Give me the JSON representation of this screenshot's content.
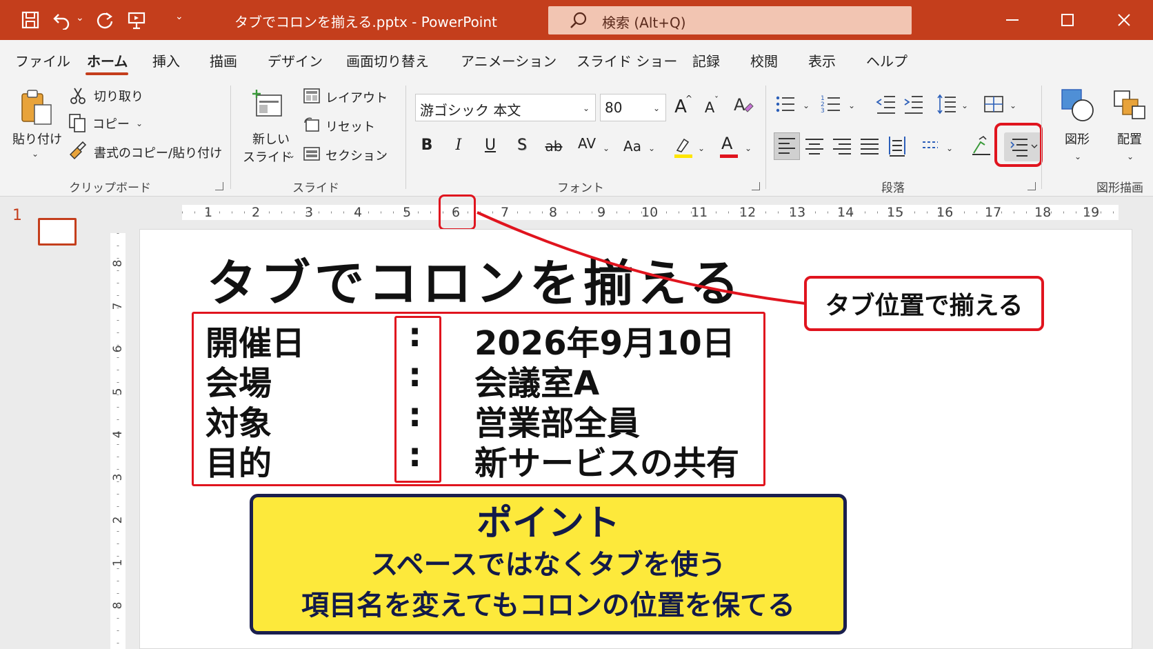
{
  "titlebar": {
    "doc_title": "タブでコロンを揃える.pptx  -  PowerPoint",
    "search_text": "検索 (Alt+Q)"
  },
  "menu": {
    "tabs": [
      "ファイル",
      "ホーム",
      "挿入",
      "描画",
      "デザイン",
      "画面切り替え",
      "アニメーション",
      "スライド ショー",
      "記録",
      "校閲",
      "表示",
      "ヘルプ"
    ],
    "active": "ホーム"
  },
  "ribbon": {
    "clipboard": {
      "paste": "貼り付け",
      "cut": "切り取り",
      "copy": "コピー",
      "format_painter": "書式のコピー/貼り付け",
      "group": "クリップボード"
    },
    "slides": {
      "new_slide_1": "新しい",
      "new_slide_2": "スライド",
      "layout": "レイアウト",
      "reset": "リセット",
      "section": "セクション",
      "group": "スライド"
    },
    "font": {
      "family": "游ゴシック 本文",
      "size": "80",
      "group": "フォント",
      "bold": "B",
      "italic": "I",
      "underline": "U",
      "shadow": "S",
      "strike": "ab",
      "spacing": "AV",
      "case": "Aa",
      "grow": "A",
      "shrink": "A",
      "color_a": "A"
    },
    "paragraph": {
      "group": "段落"
    },
    "drawing": {
      "shapes": "図形",
      "arrange": "配置",
      "group": "図形描画"
    }
  },
  "thumbnail": {
    "number": "1"
  },
  "ruler": {
    "h_numbers": [
      "1",
      "2",
      "3",
      "4",
      "5",
      "6",
      "7",
      "8",
      "9",
      "10",
      "11",
      "12",
      "13",
      "14",
      "15",
      "16",
      "17",
      "18",
      "19"
    ],
    "v_numbers": [
      "8",
      "7",
      "6",
      "5",
      "4",
      "3",
      "2",
      "1",
      "8"
    ]
  },
  "slide": {
    "title": "タブでコロンを揃える",
    "rows": [
      {
        "label": "開催日",
        "colon": ":",
        "value": "2026年9月10日"
      },
      {
        "label": "会場",
        "colon": ":",
        "value": "会議室A"
      },
      {
        "label": "対象",
        "colon": ":",
        "value": "営業部全員"
      },
      {
        "label": "目的",
        "colon": ":",
        "value": "新サービスの共有"
      }
    ],
    "callout": "タブ位置で揃える",
    "point": {
      "title": "ポイント",
      "line1": "スペースではなくタブを使う",
      "line2": "項目名を変えてもコロンの位置を保てる"
    }
  },
  "colors": {
    "accent": "#c43e1c",
    "highlight_red": "#e0141e",
    "point_bg": "#fde93b",
    "point_border": "#1a1f4e"
  }
}
